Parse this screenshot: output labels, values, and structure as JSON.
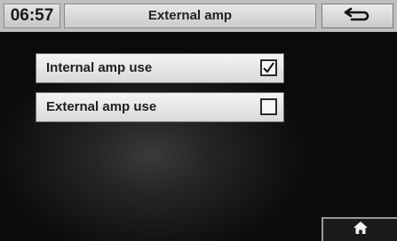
{
  "header": {
    "time": "06:57",
    "title": "External amp",
    "back_icon": "back-arrow-icon"
  },
  "options": [
    {
      "label": "Internal amp use",
      "checked": true
    },
    {
      "label": "External amp use",
      "checked": false
    }
  ],
  "footer": {
    "home_icon": "home-icon"
  },
  "colors": {
    "header_bg": "#bfbfbf",
    "option_bg": "#eeeeee",
    "screen_bg": "#151515"
  }
}
